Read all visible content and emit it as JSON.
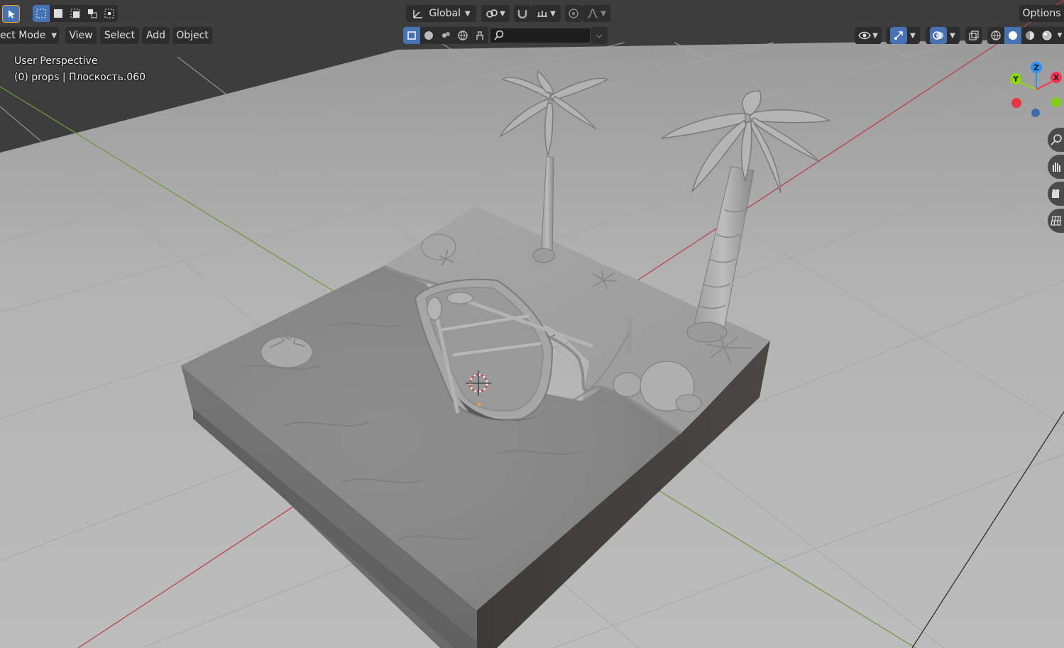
{
  "header": {
    "mode_label": "ect Mode",
    "menu": {
      "view": "View",
      "select": "Select",
      "add": "Add",
      "object": "Object"
    },
    "transform_orientation": "Global",
    "options_label": "Options"
  },
  "overlay": {
    "perspective_label": "User Perspective",
    "object_info": "(0) props | Плоскость.060"
  },
  "gizmo": {
    "z_label": "Z",
    "y_label": "Y",
    "x_label": "X"
  },
  "filter": {
    "placeholder": ""
  },
  "colors": {
    "accent": "#4772b3",
    "header_bg": "#2d2d2d",
    "axis_x": "#ff3352",
    "axis_y": "#8bdc00",
    "axis_z": "#2890ff",
    "floor": "#b9b9b9"
  },
  "icons": {
    "select_tool": "cursor-arrow-icon",
    "pivot": "pivot-icon",
    "snap": "magnet-icon",
    "proportional": "proportional-edit-icon",
    "visibility": "eye-icon",
    "gizmos": "gizmo-icon",
    "overlays": "overlay-icon",
    "xray": "xray-icon",
    "shading": [
      "wireframe-icon",
      "solid-icon",
      "material-icon",
      "rendered-icon"
    ],
    "nav": [
      "zoom-icon",
      "pan-hand-icon",
      "camera-icon",
      "ortho-grid-icon"
    ]
  }
}
